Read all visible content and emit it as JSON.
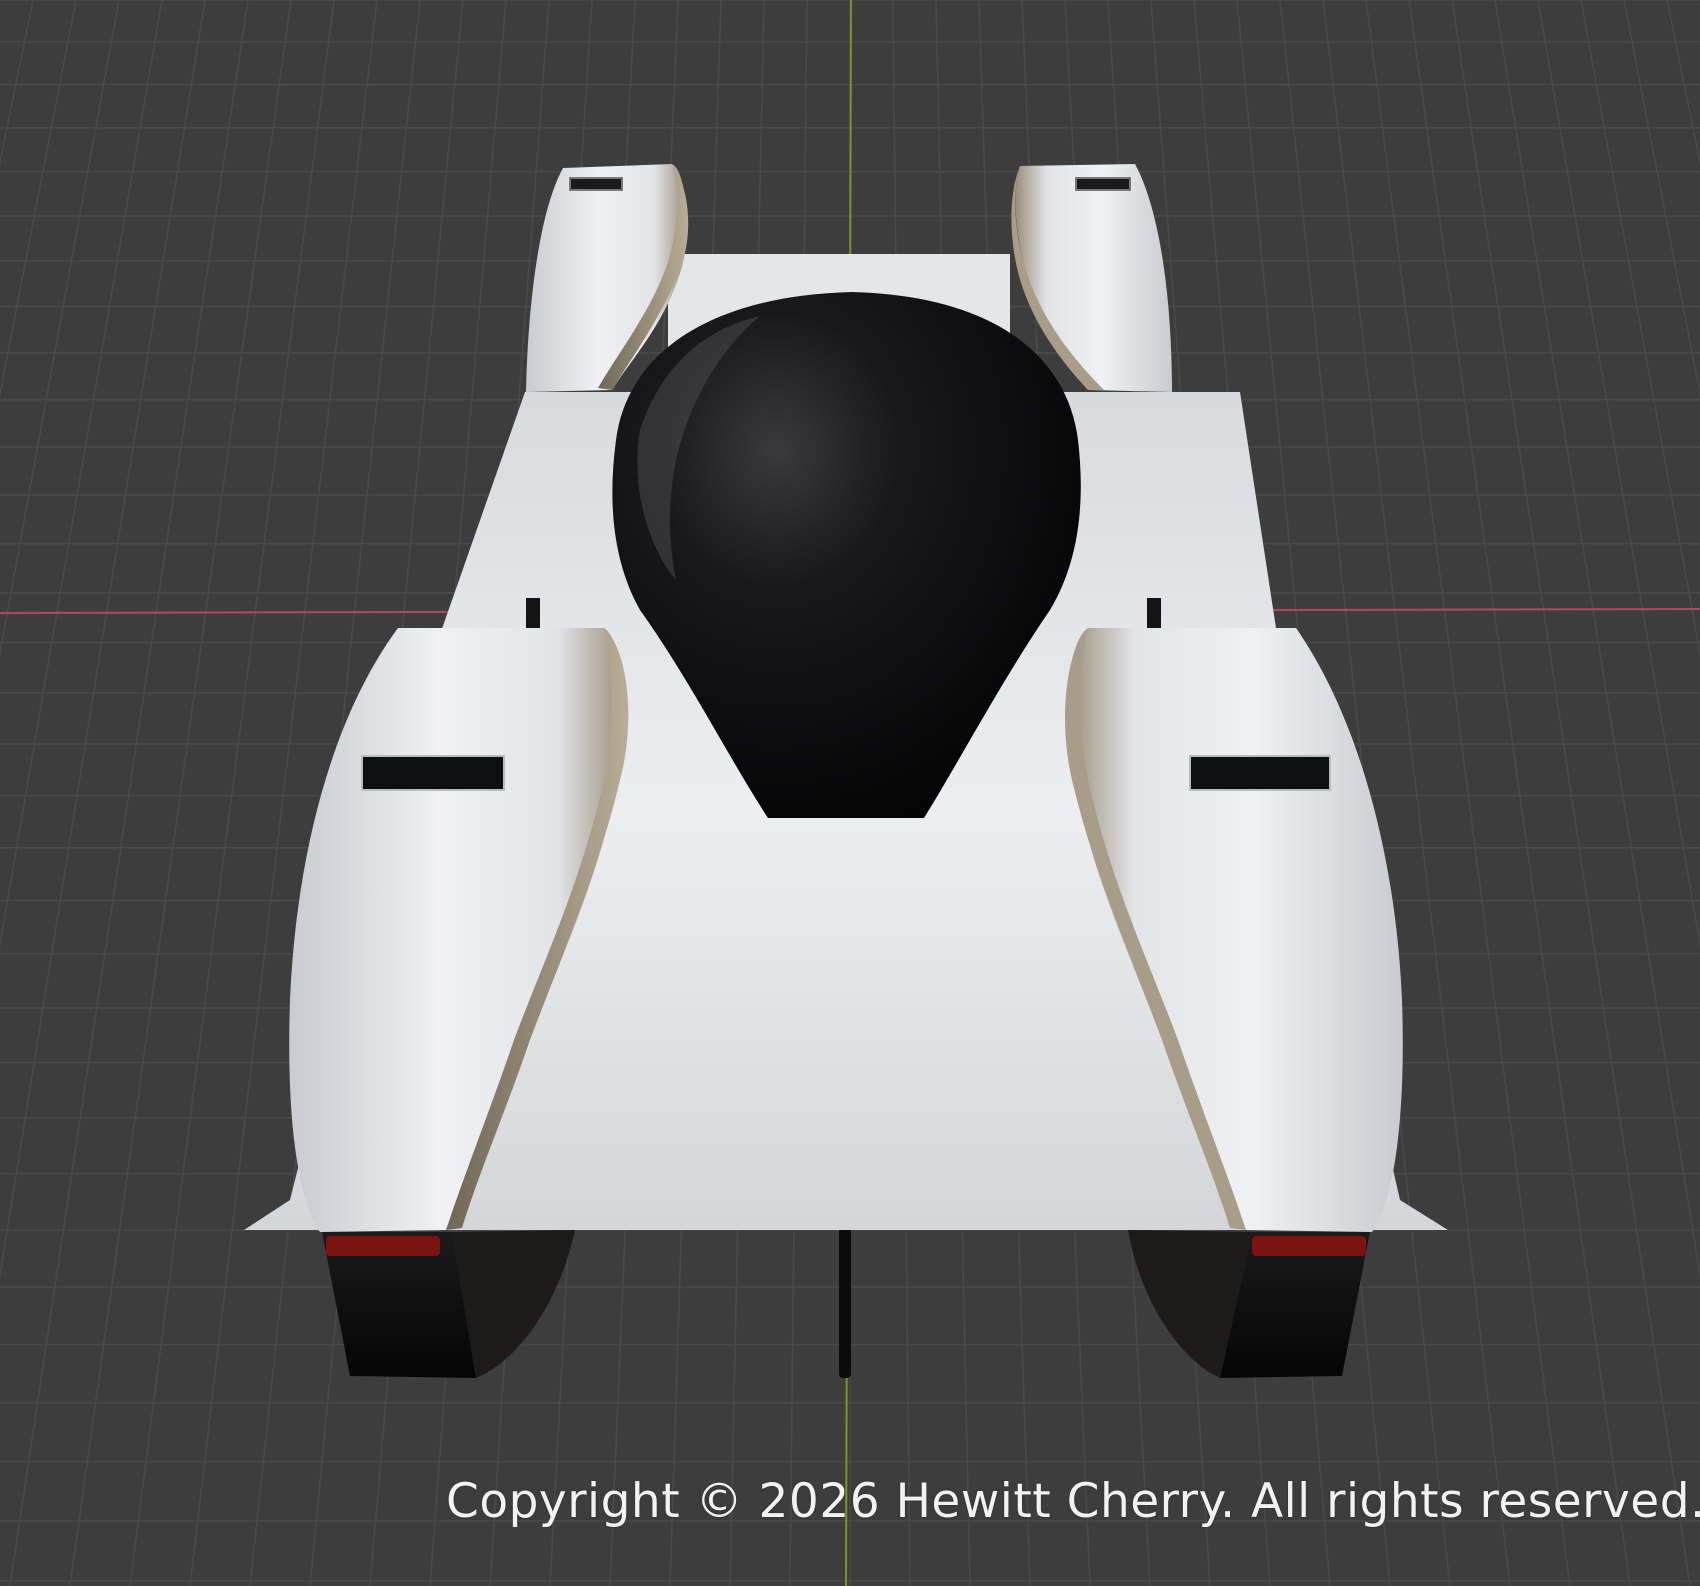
{
  "viewport": {
    "background_color": "#3d3d3d",
    "grid_color": "#4a4a4a",
    "x_axis_color": "#b04a55",
    "y_axis_color": "#6f9a2a"
  },
  "model": {
    "body_color": "#e6e8ec",
    "canopy_color": "#0a0a0c",
    "taillight_color": "#7a1410"
  },
  "watermark": {
    "text": "Copyright © 2026 Hewitt Cherry. All rights reserved."
  }
}
